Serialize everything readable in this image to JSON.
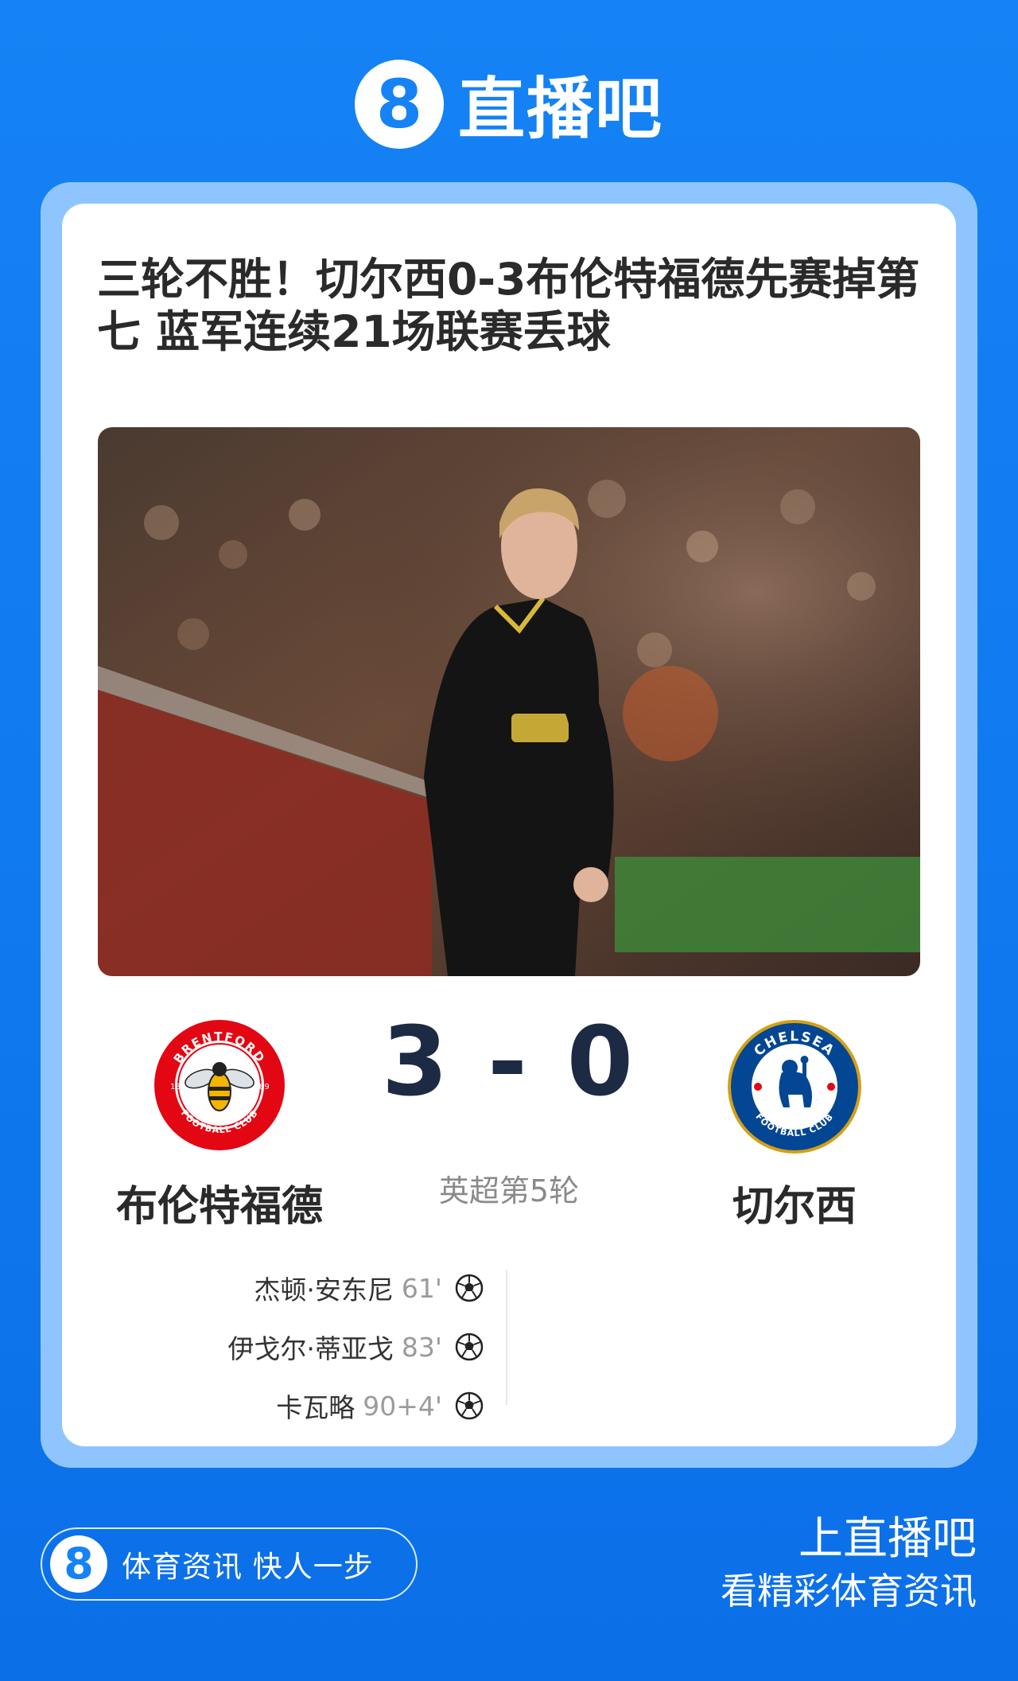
{
  "brand": {
    "logo_glyph": "8",
    "name": "直播吧"
  },
  "article": {
    "headline": "三轮不胜！切尔西0-3布伦特福德先赛掉第七 蓝军连续21场联赛丢球"
  },
  "match": {
    "home_team": "布伦特福德",
    "away_team": "切尔西",
    "score": "3 - 0",
    "round": "英超第5轮",
    "home_crest": {
      "icon": "brentford-crest-icon",
      "text_top": "BRENTFORD",
      "text_bottom": "FOOTBALL CLUB",
      "year_left": "18",
      "year_right": "89",
      "color": "#e30613"
    },
    "away_crest": {
      "icon": "chelsea-crest-icon",
      "text_top": "CHELSEA",
      "text_bottom": "FOOTBALL CLUB",
      "color": "#034694"
    },
    "goals": [
      {
        "player": "杰顿·安东尼",
        "minute": "61'"
      },
      {
        "player": "伊戈尔·蒂亚戈",
        "minute": "83'"
      },
      {
        "player": "卡瓦略",
        "minute": "90+4'"
      }
    ]
  },
  "footer": {
    "pill_glyph": "8",
    "pill_text": "体育资讯 快人一步",
    "title": "上直播吧",
    "subtitle": "看精彩体育资讯"
  },
  "colors": {
    "background": "#1582f5",
    "frame": "#8fc5ff",
    "score": "#1c2a44"
  }
}
